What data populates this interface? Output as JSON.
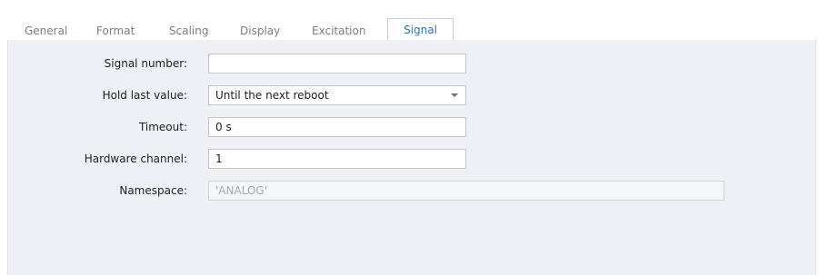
{
  "tabs": [
    {
      "label": "General",
      "active": false
    },
    {
      "label": "Format",
      "active": false
    },
    {
      "label": "Scaling",
      "active": false
    },
    {
      "label": "Display",
      "active": false
    },
    {
      "label": "Excitation",
      "active": false
    },
    {
      "label": "Signal",
      "active": true
    }
  ],
  "form": {
    "signal_number": {
      "label": "Signal number:",
      "value": ""
    },
    "hold_last_value": {
      "label": "Hold last value:",
      "value": "Until the next reboot"
    },
    "timeout": {
      "label": "Timeout:",
      "value": "0 s"
    },
    "hardware_channel": {
      "label": "Hardware channel:",
      "value": "1"
    },
    "namespace": {
      "label": "Namespace:",
      "value": "'ANALOG'",
      "disabled": true
    }
  },
  "icons": {
    "dropdown": "chevron-down-icon"
  },
  "colors": {
    "active_tab_text": "#3170b5",
    "inactive_tab_text": "#7d7d7d",
    "panel_background": "#eef0f5",
    "disabled_text": "#a9a9a9"
  }
}
